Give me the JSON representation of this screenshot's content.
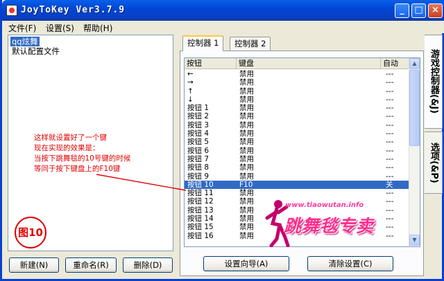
{
  "window": {
    "title": "JoyToKey Ver3.7.9"
  },
  "titlebar": {
    "min_label": "_",
    "max_label": "□",
    "close_label": "×"
  },
  "menu": [
    "文件(F)",
    "设置(S)",
    "帮助(H)"
  ],
  "profiles": {
    "items": [
      "qq炫舞",
      "默认配置文件"
    ],
    "selected_index": 0
  },
  "annotation": {
    "lines": [
      "这样就设置好了一个键",
      "现在实现的效果是：",
      "当按下跳舞毯的10号键的时候",
      "等同于按下键盘上的F10键"
    ],
    "figure_label": "图10"
  },
  "left_buttons": [
    "新建(N)",
    "重命名(R)",
    "删除(D)"
  ],
  "tabs": [
    "控制器 1",
    "控制器 2"
  ],
  "side_tabs": [
    "游戏控制器(&J)",
    "选项(&P)"
  ],
  "table": {
    "headers": [
      "按钮",
      "键盘",
      "自动"
    ],
    "rows": [
      [
        "←",
        "禁用",
        "---"
      ],
      [
        "→",
        "禁用",
        "---"
      ],
      [
        "↑",
        "禁用",
        "---"
      ],
      [
        "↓",
        "禁用",
        "---"
      ],
      [
        "按钮 1",
        "禁用",
        "---"
      ],
      [
        "按钮 2",
        "禁用",
        "---"
      ],
      [
        "按钮 3",
        "禁用",
        "---"
      ],
      [
        "按钮 4",
        "禁用",
        "---"
      ],
      [
        "按钮 5",
        "禁用",
        "---"
      ],
      [
        "按钮 6",
        "禁用",
        "---"
      ],
      [
        "按钮 7",
        "禁用",
        "---"
      ],
      [
        "按钮 8",
        "禁用",
        "---"
      ],
      [
        "按钮 9",
        "禁用",
        "---"
      ],
      [
        "按钮 10",
        "F10",
        "关"
      ],
      [
        "按钮 11",
        "禁用",
        "---"
      ],
      [
        "按钮 12",
        "禁用",
        "---"
      ],
      [
        "按钮 13",
        "禁用",
        "---"
      ],
      [
        "按钮 14",
        "禁用",
        "---"
      ],
      [
        "按钮 15",
        "禁用",
        "---"
      ],
      [
        "按钮 16",
        "禁用",
        "---"
      ]
    ],
    "selected_index": 13
  },
  "bottom_buttons": [
    "设置向导(A)",
    "清除设置(C)"
  ],
  "watermark": {
    "url": "www.tiaowutan.info",
    "text": "跳舞毯专卖"
  },
  "colors": {
    "annotation": "#e00000",
    "selection": "#316ac5",
    "title_bar": "#0a5fe8",
    "watermark": "#ff2d8e"
  }
}
